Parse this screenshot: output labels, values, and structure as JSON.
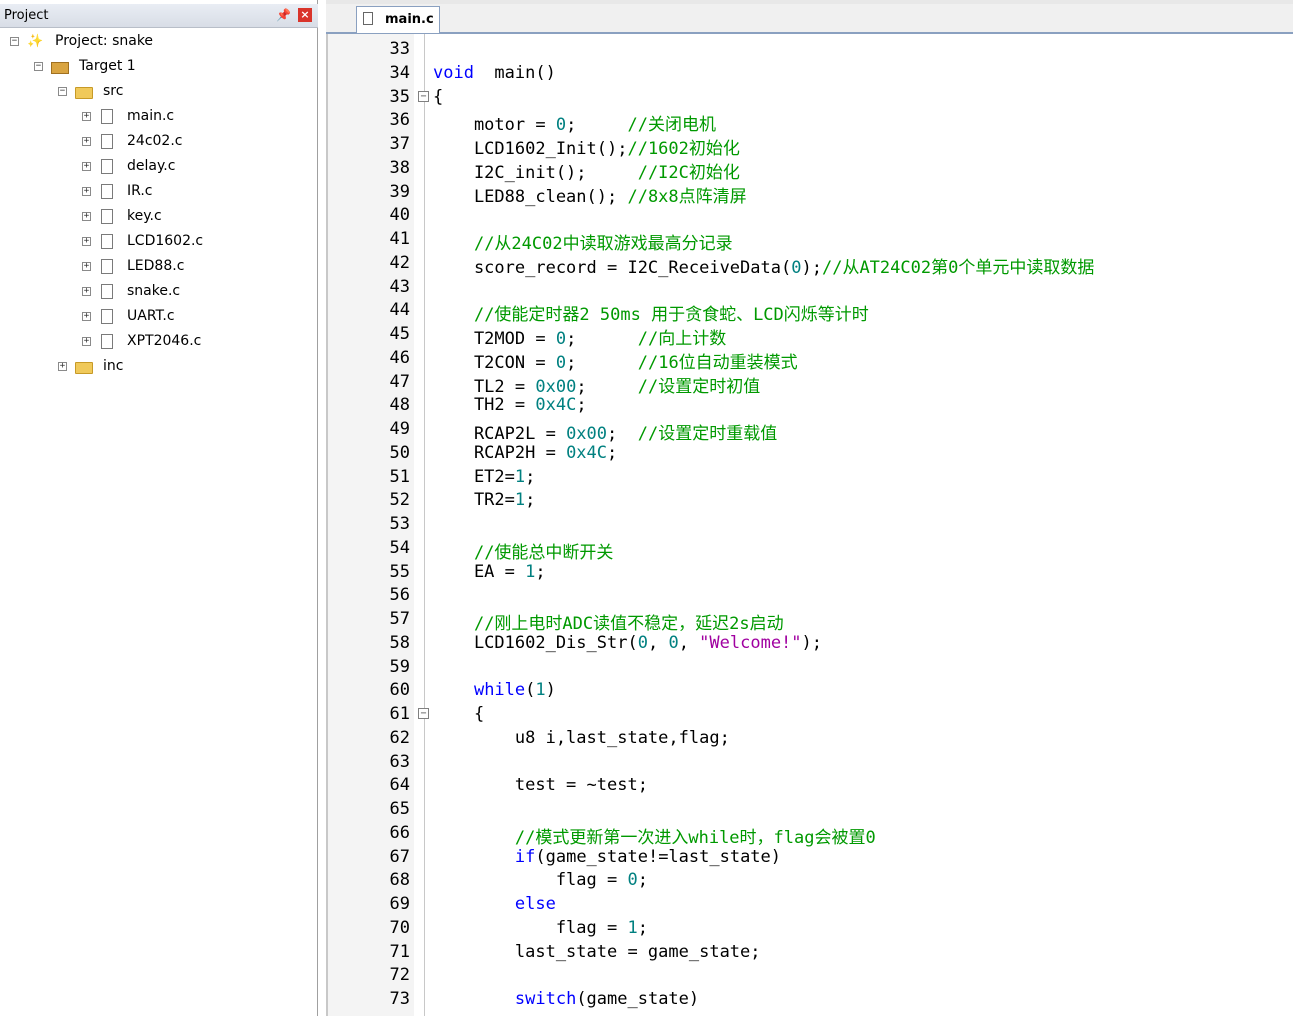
{
  "project_panel": {
    "title": "Project",
    "tree": [
      {
        "label": "Project: snake",
        "icon": "project-icon",
        "toggle": "−",
        "indent": 0
      },
      {
        "label": "Target 1",
        "icon": "target-icon",
        "toggle": "−",
        "indent": 1
      },
      {
        "label": "src",
        "icon": "folder-open-icon",
        "toggle": "−",
        "indent": 2
      },
      {
        "label": "main.c",
        "icon": "file-icon",
        "toggle": "+",
        "indent": 3
      },
      {
        "label": "24c02.c",
        "icon": "file-icon",
        "toggle": "+",
        "indent": 3
      },
      {
        "label": "delay.c",
        "icon": "file-icon",
        "toggle": "+",
        "indent": 3
      },
      {
        "label": "IR.c",
        "icon": "file-icon",
        "toggle": "+",
        "indent": 3
      },
      {
        "label": "key.c",
        "icon": "file-icon",
        "toggle": "+",
        "indent": 3
      },
      {
        "label": "LCD1602.c",
        "icon": "file-icon",
        "toggle": "+",
        "indent": 3
      },
      {
        "label": "LED88.c",
        "icon": "file-icon",
        "toggle": "+",
        "indent": 3
      },
      {
        "label": "snake.c",
        "icon": "file-icon",
        "toggle": "+",
        "indent": 3
      },
      {
        "label": "UART.c",
        "icon": "file-icon",
        "toggle": "+",
        "indent": 3
      },
      {
        "label": "XPT2046.c",
        "icon": "file-icon",
        "toggle": "+",
        "indent": 3
      },
      {
        "label": "inc",
        "icon": "folder-icon",
        "toggle": "+",
        "indent": 2
      }
    ]
  },
  "editor": {
    "tab_label": "main.c",
    "lines": [
      {
        "n": "33",
        "fold": "",
        "segs": []
      },
      {
        "n": "34",
        "fold": "",
        "segs": [
          [
            "kw",
            "void"
          ],
          [
            "",
            "  main()"
          ]
        ]
      },
      {
        "n": "35",
        "fold": "−",
        "segs": [
          [
            "",
            "{"
          ]
        ]
      },
      {
        "n": "36",
        "fold": "",
        "segs": [
          [
            "",
            "    motor = "
          ],
          [
            "num",
            "0"
          ],
          [
            "",
            ";     "
          ],
          [
            "cm",
            "//关闭电机"
          ]
        ]
      },
      {
        "n": "37",
        "fold": "",
        "segs": [
          [
            "",
            "    LCD1602_Init();"
          ],
          [
            "cm",
            "//1602初始化"
          ]
        ]
      },
      {
        "n": "38",
        "fold": "",
        "segs": [
          [
            "",
            "    I2C_init();     "
          ],
          [
            "cm",
            "//I2C初始化"
          ]
        ]
      },
      {
        "n": "39",
        "fold": "",
        "segs": [
          [
            "",
            "    LED88_clean(); "
          ],
          [
            "cm",
            "//8x8点阵清屏"
          ]
        ]
      },
      {
        "n": "40",
        "fold": "",
        "segs": []
      },
      {
        "n": "41",
        "fold": "",
        "segs": [
          [
            "",
            "    "
          ],
          [
            "cm",
            "//从24C02中读取游戏最高分记录"
          ]
        ]
      },
      {
        "n": "42",
        "fold": "",
        "segs": [
          [
            "",
            "    score_record = I2C_ReceiveData("
          ],
          [
            "num",
            "0"
          ],
          [
            "",
            ");"
          ],
          [
            "cm",
            "//从AT24C02第0个单元中读取数据"
          ]
        ]
      },
      {
        "n": "43",
        "fold": "",
        "segs": []
      },
      {
        "n": "44",
        "fold": "",
        "segs": [
          [
            "",
            "    "
          ],
          [
            "cm",
            "//使能定时器2 50ms 用于贪食蛇、LCD闪烁等计时"
          ]
        ]
      },
      {
        "n": "45",
        "fold": "",
        "segs": [
          [
            "",
            "    T2MOD = "
          ],
          [
            "num",
            "0"
          ],
          [
            "",
            ";      "
          ],
          [
            "cm",
            "//向上计数"
          ]
        ]
      },
      {
        "n": "46",
        "fold": "",
        "segs": [
          [
            "",
            "    T2CON = "
          ],
          [
            "num",
            "0"
          ],
          [
            "",
            ";      "
          ],
          [
            "cm",
            "//16位自动重装模式"
          ]
        ]
      },
      {
        "n": "47",
        "fold": "",
        "segs": [
          [
            "",
            "    TL2 = "
          ],
          [
            "num",
            "0x00"
          ],
          [
            "",
            ";     "
          ],
          [
            "cm",
            "//设置定时初值"
          ]
        ]
      },
      {
        "n": "48",
        "fold": "",
        "segs": [
          [
            "",
            "    TH2 = "
          ],
          [
            "num",
            "0x4C"
          ],
          [
            "",
            ";"
          ]
        ]
      },
      {
        "n": "49",
        "fold": "",
        "segs": [
          [
            "",
            "    RCAP2L = "
          ],
          [
            "num",
            "0x00"
          ],
          [
            "",
            ";  "
          ],
          [
            "cm",
            "//设置定时重载值"
          ]
        ]
      },
      {
        "n": "50",
        "fold": "",
        "segs": [
          [
            "",
            "    RCAP2H = "
          ],
          [
            "num",
            "0x4C"
          ],
          [
            "",
            ";"
          ]
        ]
      },
      {
        "n": "51",
        "fold": "",
        "segs": [
          [
            "",
            "    ET2="
          ],
          [
            "num",
            "1"
          ],
          [
            "",
            ";"
          ]
        ]
      },
      {
        "n": "52",
        "fold": "",
        "segs": [
          [
            "",
            "    TR2="
          ],
          [
            "num",
            "1"
          ],
          [
            "",
            ";"
          ]
        ]
      },
      {
        "n": "53",
        "fold": "",
        "segs": []
      },
      {
        "n": "54",
        "fold": "",
        "segs": [
          [
            "",
            "    "
          ],
          [
            "cm",
            "//使能总中断开关"
          ]
        ]
      },
      {
        "n": "55",
        "fold": "",
        "segs": [
          [
            "",
            "    EA = "
          ],
          [
            "num",
            "1"
          ],
          [
            "",
            ";"
          ]
        ]
      },
      {
        "n": "56",
        "fold": "",
        "segs": []
      },
      {
        "n": "57",
        "fold": "",
        "segs": [
          [
            "",
            "    "
          ],
          [
            "cm",
            "//刚上电时ADC读值不稳定，延迟2s启动"
          ]
        ]
      },
      {
        "n": "58",
        "fold": "",
        "segs": [
          [
            "",
            "    LCD1602_Dis_Str("
          ],
          [
            "num",
            "0"
          ],
          [
            "",
            ", "
          ],
          [
            "num",
            "0"
          ],
          [
            "",
            ", "
          ],
          [
            "str",
            "\"Welcome!\""
          ],
          [
            "",
            ");"
          ]
        ]
      },
      {
        "n": "59",
        "fold": "",
        "segs": []
      },
      {
        "n": "60",
        "fold": "",
        "segs": [
          [
            "",
            "    "
          ],
          [
            "kw",
            "while"
          ],
          [
            "",
            "("
          ],
          [
            "num",
            "1"
          ],
          [
            "",
            ")"
          ]
        ]
      },
      {
        "n": "61",
        "fold": "−",
        "segs": [
          [
            "",
            "    {"
          ]
        ]
      },
      {
        "n": "62",
        "fold": "",
        "segs": [
          [
            "",
            "        u8 i,last_state,flag;"
          ]
        ]
      },
      {
        "n": "63",
        "fold": "",
        "segs": []
      },
      {
        "n": "64",
        "fold": "",
        "segs": [
          [
            "",
            "        test = ~test;"
          ]
        ]
      },
      {
        "n": "65",
        "fold": "",
        "segs": []
      },
      {
        "n": "66",
        "fold": "",
        "segs": [
          [
            "",
            "        "
          ],
          [
            "cm",
            "//模式更新第一次进入while时，flag会被置0"
          ]
        ]
      },
      {
        "n": "67",
        "fold": "",
        "segs": [
          [
            "",
            "        "
          ],
          [
            "kw",
            "if"
          ],
          [
            "",
            "(game_state!=last_state)"
          ]
        ]
      },
      {
        "n": "68",
        "fold": "",
        "segs": [
          [
            "",
            "            flag = "
          ],
          [
            "num",
            "0"
          ],
          [
            "",
            ";"
          ]
        ]
      },
      {
        "n": "69",
        "fold": "",
        "segs": [
          [
            "",
            "        "
          ],
          [
            "kw",
            "else"
          ]
        ]
      },
      {
        "n": "70",
        "fold": "",
        "segs": [
          [
            "",
            "            flag = "
          ],
          [
            "num",
            "1"
          ],
          [
            "",
            ";"
          ]
        ]
      },
      {
        "n": "71",
        "fold": "",
        "segs": [
          [
            "",
            "        last_state = game_state;"
          ]
        ]
      },
      {
        "n": "72",
        "fold": "",
        "segs": []
      },
      {
        "n": "73",
        "fold": "",
        "segs": [
          [
            "",
            "        "
          ],
          [
            "kw",
            "switch"
          ],
          [
            "",
            "(game_state)"
          ]
        ]
      }
    ]
  }
}
